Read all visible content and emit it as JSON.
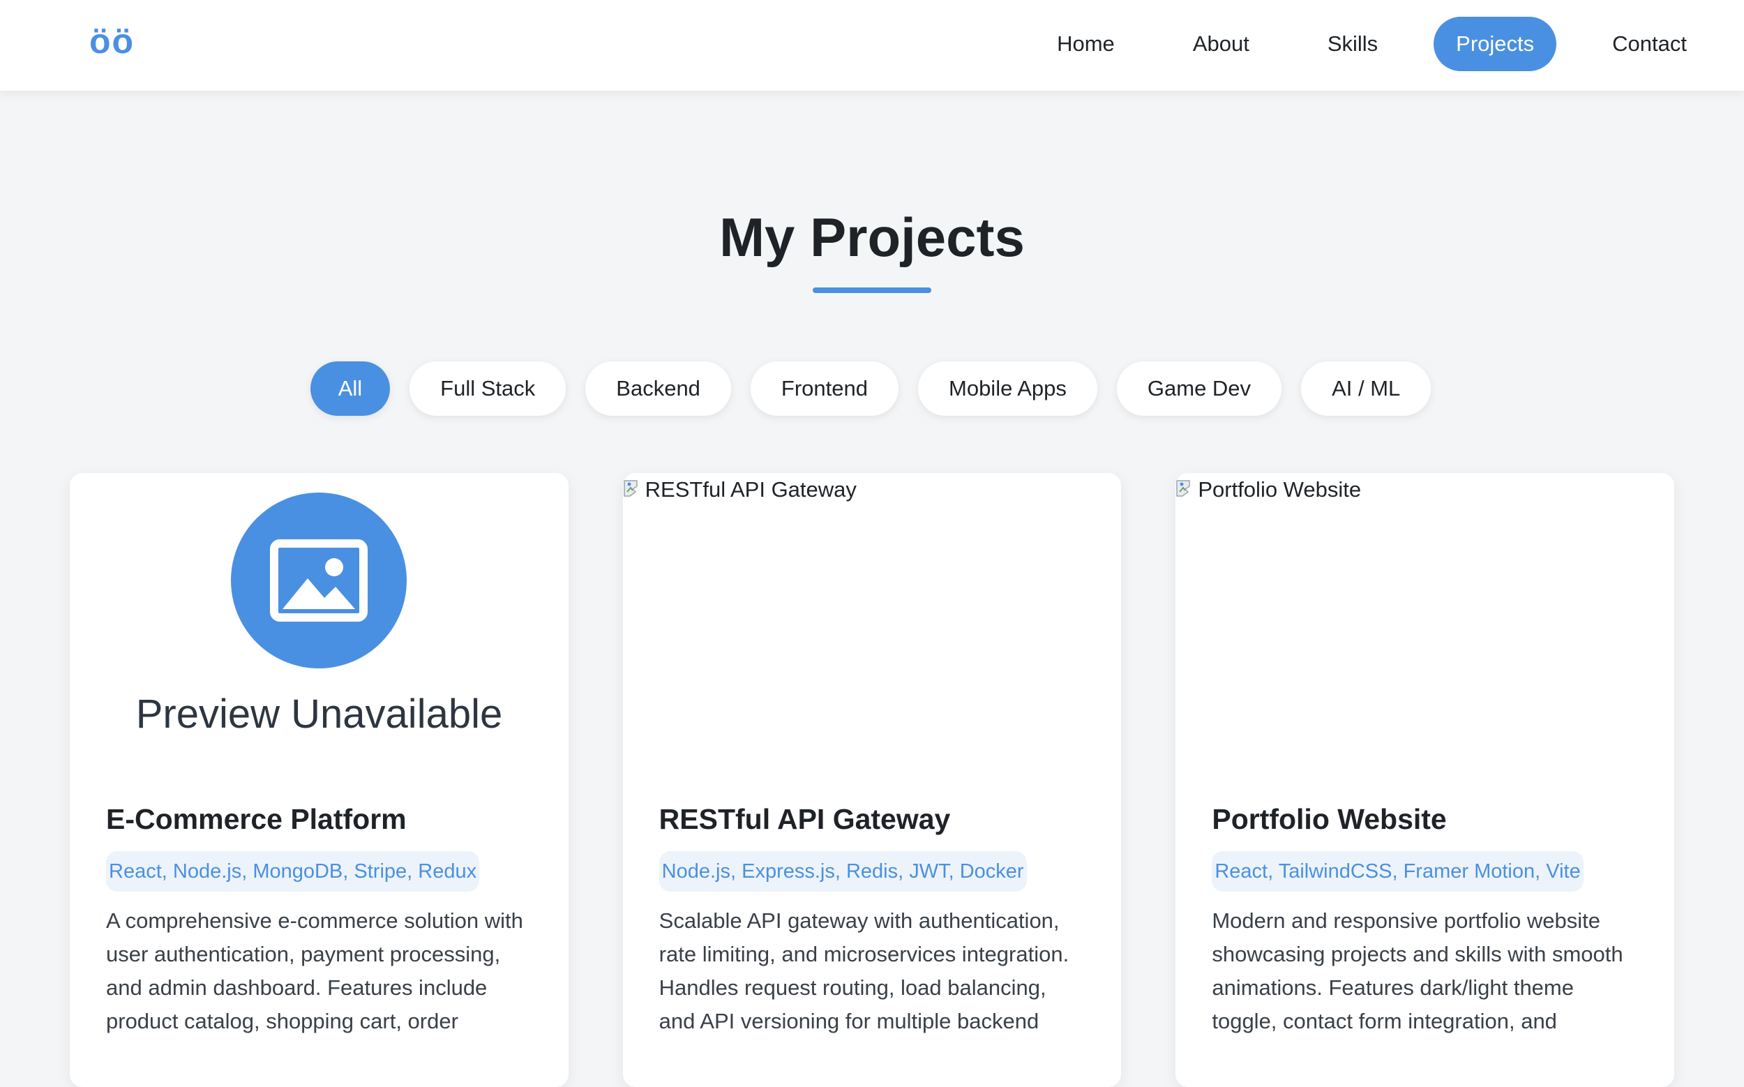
{
  "nav": {
    "logo": "öö",
    "links": [
      {
        "label": "Home",
        "active": false
      },
      {
        "label": "About",
        "active": false
      },
      {
        "label": "Skills",
        "active": false
      },
      {
        "label": "Projects",
        "active": true
      },
      {
        "label": "Contact",
        "active": false
      }
    ]
  },
  "page": {
    "title": "My Projects"
  },
  "filters": [
    {
      "label": "All",
      "active": true
    },
    {
      "label": "Full Stack",
      "active": false
    },
    {
      "label": "Backend",
      "active": false
    },
    {
      "label": "Frontend",
      "active": false
    },
    {
      "label": "Mobile Apps",
      "active": false
    },
    {
      "label": "Game Dev",
      "active": false
    },
    {
      "label": "AI / ML",
      "active": false
    }
  ],
  "projects": [
    {
      "media": "placeholder",
      "placeholder_text": "Preview Unavailable",
      "image_alt": "",
      "title": "E-Commerce Platform",
      "tech": "React, Node.js, MongoDB, Stripe, Redux",
      "description": "A comprehensive e-commerce solution with user authentication, payment processing, and admin dashboard. Features include product catalog, shopping cart, order"
    },
    {
      "media": "broken-image",
      "placeholder_text": "",
      "image_alt": "RESTful API Gateway",
      "title": "RESTful API Gateway",
      "tech": "Node.js, Express.js, Redis, JWT, Docker",
      "description": "Scalable API gateway with authentication, rate limiting, and microservices integration. Handles request routing, load balancing, and API versioning for multiple backend"
    },
    {
      "media": "broken-image",
      "placeholder_text": "",
      "image_alt": "Portfolio Website",
      "title": "Portfolio Website",
      "tech": "React, TailwindCSS, Framer Motion, Vite",
      "description": "Modern and responsive portfolio website showcasing projects and skills with smooth animations. Features dark/light theme toggle, contact form integration, and"
    }
  ],
  "colors": {
    "accent": "#4a90e2",
    "background": "#f4f5f7",
    "card": "#ffffff",
    "tag_bg": "#edf3fb"
  },
  "icons": {
    "placeholder": "image-icon",
    "broken": "broken-image-icon"
  }
}
